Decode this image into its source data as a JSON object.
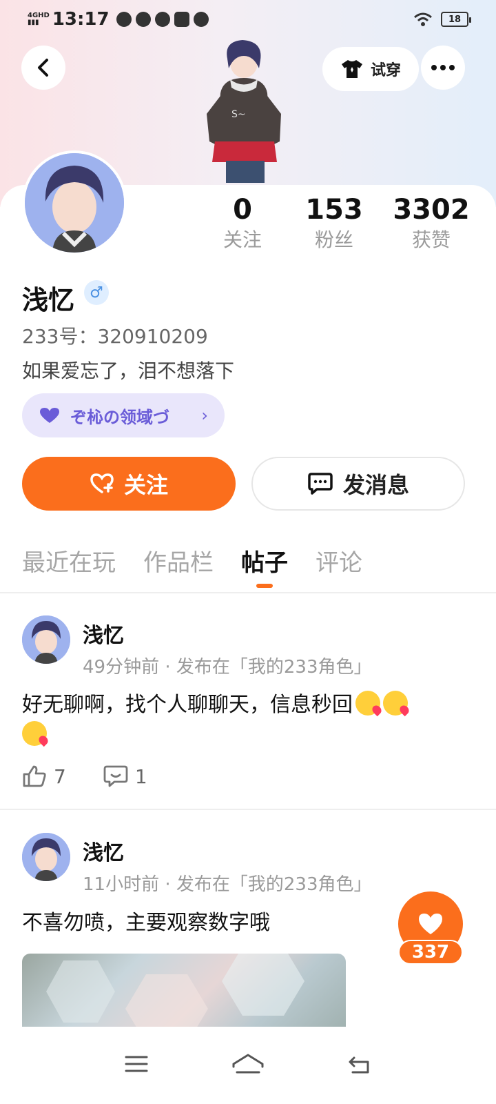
{
  "status_bar": {
    "network": "4GHD",
    "time": "13:17",
    "battery": "18"
  },
  "header": {
    "try_on_label": "试穿"
  },
  "profile": {
    "stats": [
      {
        "value": "0",
        "label": "关注"
      },
      {
        "value": "153",
        "label": "粉丝"
      },
      {
        "value": "3302",
        "label": "获赞"
      }
    ],
    "name": "浅忆",
    "gender_symbol": "♂",
    "uid": "233号：320910209",
    "bio": "如果爱忘了，泪不想落下",
    "domain_label": "ぞ杺の领域づ"
  },
  "actions": {
    "follow": "关注",
    "message": "发消息"
  },
  "tabs": [
    "最近在玩",
    "作品栏",
    "帖子",
    "评论"
  ],
  "posts": [
    {
      "author": "浅忆",
      "meta": "49分钟前 · 发布在「我的233角色」",
      "text": "好无聊啊，找个人聊聊天，信息秒回",
      "likes": "7",
      "comments": "1"
    },
    {
      "author": "浅忆",
      "meta": "11小时前 · 发布在「我的233角色」",
      "text": "不喜勿喷，主要观察数字哦"
    }
  ],
  "floating_like": {
    "count": "337"
  },
  "colors": {
    "accent": "#fb6e1c",
    "domain_purple": "#6a5cd8"
  }
}
